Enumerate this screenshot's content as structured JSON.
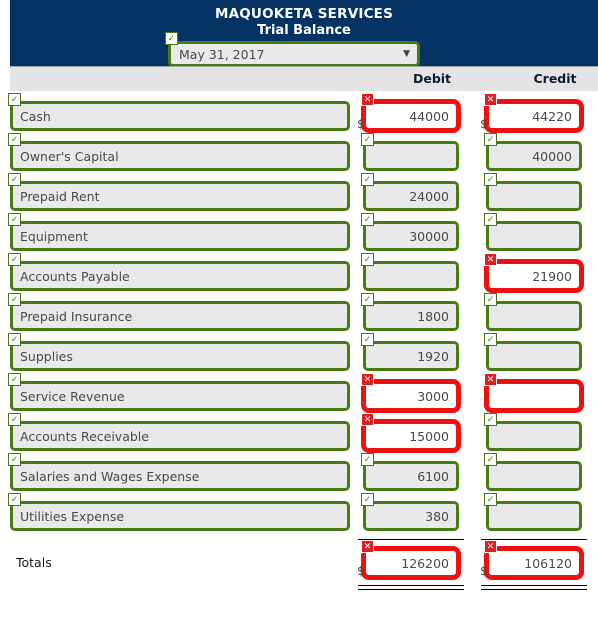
{
  "header": {
    "company": "MAQUOKETA SERVICES",
    "statement": "Trial Balance",
    "date_select": {
      "value": "May 31, 2017",
      "arrow_icon": "chevron-down-icon",
      "status": "ok"
    },
    "accent_navy": "#043363",
    "accent_green": "#4a7a12",
    "accent_red": "#ee1111"
  },
  "columns": {
    "account": "",
    "debit": "Debit",
    "credit": "Credit"
  },
  "currency_symbol": "$",
  "rows": [
    {
      "name": "Cash",
      "name_status": "ok",
      "debit": "44000",
      "debit_status": "bad",
      "debit_dollar": true,
      "credit": "44220",
      "credit_status": "bad",
      "credit_dollar": true
    },
    {
      "name": "Owner's Capital",
      "name_status": "ok",
      "debit": "",
      "debit_status": "ok",
      "debit_dollar": false,
      "credit": "40000",
      "credit_status": "ok",
      "credit_dollar": false
    },
    {
      "name": "Prepaid Rent",
      "name_status": "ok",
      "debit": "24000",
      "debit_status": "ok",
      "debit_dollar": false,
      "credit": "",
      "credit_status": "ok",
      "credit_dollar": false
    },
    {
      "name": "Equipment",
      "name_status": "ok",
      "debit": "30000",
      "debit_status": "ok",
      "debit_dollar": false,
      "credit": "",
      "credit_status": "ok",
      "credit_dollar": false
    },
    {
      "name": "Accounts Payable",
      "name_status": "ok",
      "debit": "",
      "debit_status": "ok",
      "debit_dollar": false,
      "credit": "21900",
      "credit_status": "bad",
      "credit_dollar": false
    },
    {
      "name": "Prepaid Insurance",
      "name_status": "ok",
      "debit": "1800",
      "debit_status": "ok",
      "debit_dollar": false,
      "credit": "",
      "credit_status": "ok",
      "credit_dollar": false
    },
    {
      "name": "Supplies",
      "name_status": "ok",
      "debit": "1920",
      "debit_status": "ok",
      "debit_dollar": false,
      "credit": "",
      "credit_status": "ok",
      "credit_dollar": false
    },
    {
      "name": "Service Revenue",
      "name_status": "ok",
      "debit": "3000",
      "debit_status": "bad",
      "debit_dollar": false,
      "credit": "",
      "credit_status": "bad",
      "credit_dollar": false
    },
    {
      "name": "Accounts Receivable",
      "name_status": "ok",
      "debit": "15000",
      "debit_status": "bad",
      "debit_dollar": false,
      "credit": "",
      "credit_status": "ok",
      "credit_dollar": false
    },
    {
      "name": "Salaries and Wages Expense",
      "name_status": "ok",
      "debit": "6100",
      "debit_status": "ok",
      "debit_dollar": false,
      "credit": "",
      "credit_status": "ok",
      "credit_dollar": false
    },
    {
      "name": "Utilities Expense",
      "name_status": "ok",
      "debit": "380",
      "debit_status": "ok",
      "debit_dollar": false,
      "credit": "",
      "credit_status": "ok",
      "credit_dollar": false
    }
  ],
  "totals": {
    "label": "Totals",
    "debit": "126200",
    "debit_status": "bad",
    "debit_dollar": true,
    "credit": "106120",
    "credit_status": "bad",
    "credit_dollar": true
  },
  "icons": {
    "ok_badge": "checkmark-icon",
    "bad_badge": "cross-icon"
  }
}
